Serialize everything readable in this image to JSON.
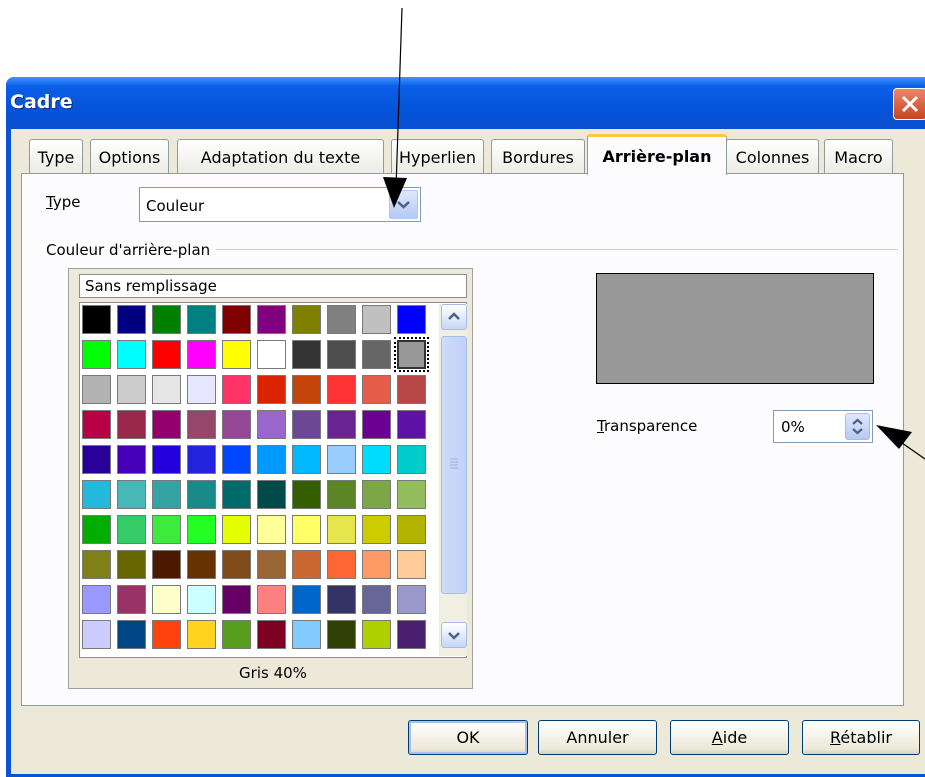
{
  "window": {
    "title": "Cadre"
  },
  "tabs": [
    {
      "label": "Type"
    },
    {
      "label": "Options"
    },
    {
      "label": "Adaptation du texte"
    },
    {
      "label": "Hyperlien"
    },
    {
      "label": "Bordures"
    },
    {
      "label": "Arrière-plan"
    },
    {
      "label": "Colonnes"
    },
    {
      "label": "Macro"
    }
  ],
  "active_tab": "Arrière-plan",
  "type_field": {
    "label_rest": "ype",
    "label_mnemonic": "T",
    "value": "Couleur"
  },
  "background_group": {
    "label": "Couleur d'arrière-plan"
  },
  "palette": {
    "no_fill_label": "Sans remplissage",
    "selected_name": "Gris 40%",
    "rows": [
      [
        "#000000",
        "#000080",
        "#008000",
        "#008080",
        "#800000",
        "#800080",
        "#808000",
        "#808080",
        "#c0c0c0",
        "#0000ff"
      ],
      [
        "#00ff00",
        "#00ffff",
        "#ff0000",
        "#ff00ff",
        "#ffff00",
        "#ffffff",
        "#333333",
        "#4d4d4d",
        "#666666",
        "#999999"
      ],
      [
        "#b3b3b3",
        "#cccccc",
        "#e6e6e6",
        "#e6e6ff",
        "#ff3366",
        "#dc2300",
        "#c5440a",
        "#ff3333",
        "#e65d4a",
        "#b84747"
      ],
      [
        "#b80047",
        "#99284c",
        "#94006b",
        "#94476b",
        "#944794",
        "#9966cc",
        "#6b4794",
        "#6b2394",
        "#6b0094",
        "#5e11a6"
      ],
      [
        "#280099",
        "#4700b8",
        "#2300dc",
        "#2323dc",
        "#0047ff",
        "#0099ff",
        "#00b8ff",
        "#99ccff",
        "#00dcff",
        "#00cccc"
      ],
      [
        "#23b8dc",
        "#47b8b8",
        "#33a3a3",
        "#198a8a",
        "#006b6b",
        "#004a4a",
        "#355e00",
        "#5c8526",
        "#7da647",
        "#94bd5e"
      ],
      [
        "#00ae00",
        "#33cc66",
        "#3deb3d",
        "#23ff23",
        "#e6ff00",
        "#ffff99",
        "#ffff66",
        "#e6e64c",
        "#cccc00",
        "#b3b300"
      ],
      [
        "#808019",
        "#666600",
        "#4c1900",
        "#663300",
        "#804c19",
        "#996633",
        "#cc6633",
        "#ff6633",
        "#ff9966",
        "#ffcc99"
      ],
      [
        "#9999ff",
        "#993366",
        "#ffffcc",
        "#ccffff",
        "#660066",
        "#ff8080",
        "#0066cc",
        "#333366",
        "#666699",
        "#9999cc"
      ],
      [
        "#ccccff",
        "#004586",
        "#ff420e",
        "#ffd320",
        "#579d1c",
        "#7e0021",
        "#83caff",
        "#314004",
        "#aecf00",
        "#4b1f6f"
      ]
    ]
  },
  "preview": {
    "color": "#999999"
  },
  "transparency": {
    "label_mnemonic": "T",
    "label_rest": "ransparence",
    "value": "0%"
  },
  "buttons": {
    "ok": "OK",
    "cancel": "Annuler",
    "help_mnemonic": "A",
    "help_rest": "ide",
    "reset_mnemonic": "R",
    "reset_rest": "établir"
  },
  "colors": {
    "title_bar": "#0454d9",
    "dialog_bg": "#ece9d8",
    "active_tab_accent": "#ffc83c"
  }
}
